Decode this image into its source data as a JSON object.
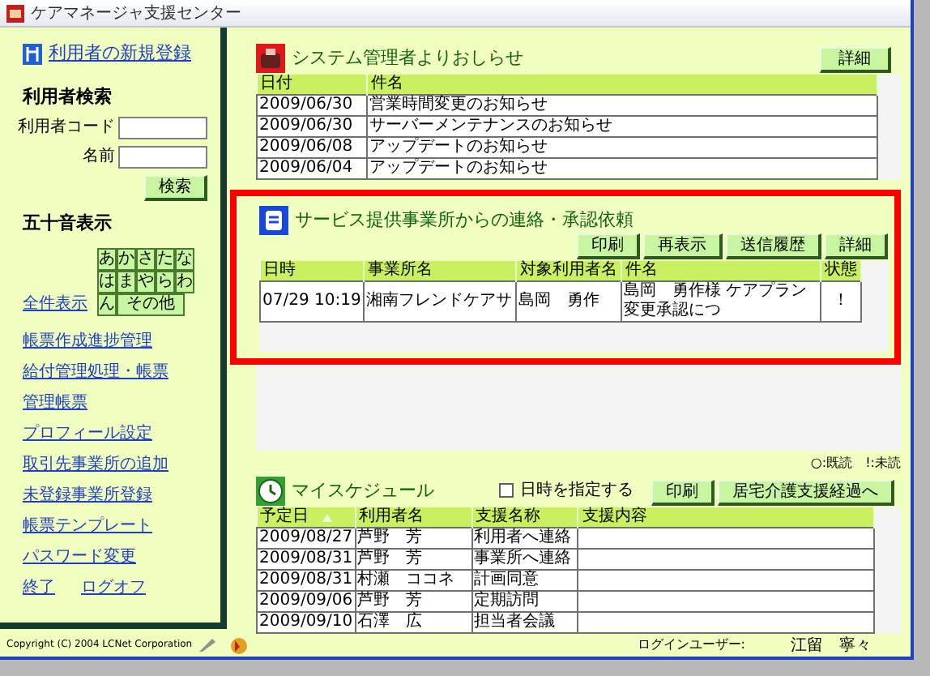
{
  "window": {
    "title": "ケアマネージャ支援センター"
  },
  "sidebar": {
    "register_link": "利用者の新規登録",
    "search": {
      "heading": "利用者検索",
      "fields": [
        {
          "label": "利用者コード"
        },
        {
          "label": "名前"
        }
      ],
      "button": "検索"
    },
    "kana": {
      "heading": "五十音表示",
      "rows": [
        [
          "あ",
          "か",
          "さ",
          "た",
          "な"
        ],
        [
          "は",
          "ま",
          "や",
          "ら",
          "わ"
        ],
        [
          "ん",
          "その他"
        ]
      ],
      "show_all": "全件表示"
    },
    "links": [
      "帳票作成進捗管理",
      "給付管理処理・帳票",
      "管理帳票",
      "プロフィール設定",
      "取引先事業所の追加",
      "未登録事業所登録",
      "帳票テンプレート",
      "パスワード変更"
    ],
    "bottom_links": [
      "終了",
      "ログオフ"
    ],
    "copyright": "Copyright (C) 2004 LCNet Corporation"
  },
  "notices": {
    "title": "システム管理者よりおしらせ",
    "buttons": [
      "詳細"
    ],
    "columns": [
      "日付",
      "件名"
    ],
    "rows": [
      [
        "2009/06/30",
        "営業時間変更のお知らせ"
      ],
      [
        "2009/06/30",
        "サーバーメンテナンスのお知らせ"
      ],
      [
        "2009/06/08",
        "アップデートのお知らせ"
      ],
      [
        "2009/06/04",
        "アップデートのお知らせ"
      ]
    ]
  },
  "requests": {
    "title": "サービス提供事業所からの連絡・承認依頼",
    "highlighted": true,
    "buttons": [
      "印刷",
      "再表示",
      "送信履歴",
      "詳細"
    ],
    "columns": [
      "日時",
      "事業所名",
      "対象利用者名",
      "件名",
      "状態"
    ],
    "rows": [
      [
        "07/29 10:19",
        "湘南フレンドケアサ",
        "島岡　勇作",
        "島岡　勇作様 ケアプラン変更承認につ",
        "！"
      ]
    ],
    "legend": "○:既読　!:未読"
  },
  "schedule": {
    "title": "マイスケジュール",
    "date_filter": {
      "label": "日時を指定する",
      "checked": false
    },
    "buttons": [
      "印刷",
      "居宅介護支援経過へ"
    ],
    "columns": [
      "予定日",
      "利用者名",
      "支援名称",
      "支援内容"
    ],
    "rows": [
      [
        "2009/08/27",
        "芦野　芳",
        "利用者へ連絡",
        ""
      ],
      [
        "2009/08/31",
        "芦野　芳",
        "事業所へ連絡",
        ""
      ],
      [
        "2009/08/31",
        "村瀬　ココネ",
        "計画同意",
        ""
      ],
      [
        "2009/09/06",
        "芦野　芳",
        "定期訪問",
        ""
      ],
      [
        "2009/09/10",
        "石澤　広",
        "担当者会議",
        ""
      ]
    ]
  },
  "status_bar": {
    "label": "ログインユーザー:",
    "user": "江留　寧々"
  }
}
